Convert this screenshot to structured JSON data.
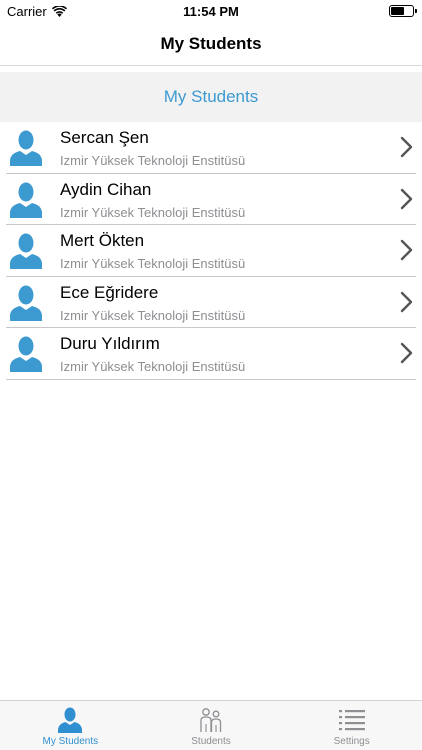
{
  "status_bar": {
    "carrier": "Carrier",
    "time": "11:54 PM"
  },
  "nav": {
    "title": "My Students"
  },
  "section": {
    "title": "My Students"
  },
  "students": [
    {
      "name": "Sercan Şen",
      "school": "Izmir Yüksek Teknoloji Enstitüsü"
    },
    {
      "name": "Aydin Cihan",
      "school": "Izmir Yüksek Teknoloji Enstitüsü"
    },
    {
      "name": "Mert Ökten",
      "school": "Izmir Yüksek Teknoloji Enstitüsü"
    },
    {
      "name": "Ece Eğridere",
      "school": "Izmir Yüksek Teknoloji Enstitüsü"
    },
    {
      "name": "Duru Yıldırım",
      "school": "Izmir Yüksek Teknoloji Enstitüsü"
    }
  ],
  "tabs": [
    {
      "label": "My Students",
      "icon": "person-icon",
      "active": true
    },
    {
      "label": "Students",
      "icon": "people-icon",
      "active": false
    },
    {
      "label": "Settings",
      "icon": "list-icon",
      "active": false
    }
  ],
  "colors": {
    "accent": "#3d9ad1",
    "avatar": "#3d9ad1",
    "inactive": "#8e8e93"
  }
}
